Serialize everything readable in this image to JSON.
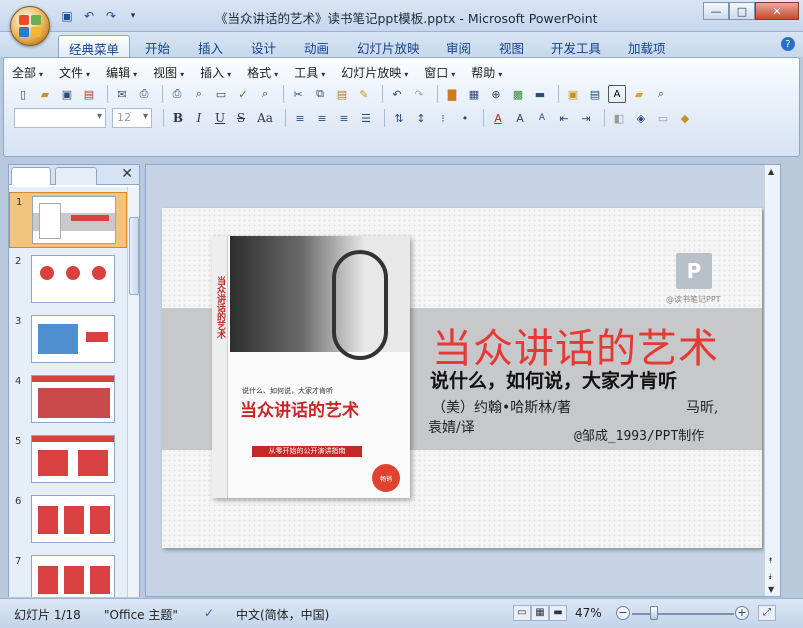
{
  "window": {
    "title": "《当众讲话的艺术》读书笔记ppt模板.pptx - Microsoft PowerPoint",
    "min_label": "—",
    "max_label": "□",
    "close_label": "✕"
  },
  "ribbon_tabs": [
    "经典菜单",
    "开始",
    "插入",
    "设计",
    "动画",
    "幻灯片放映",
    "审阅",
    "视图",
    "开发工具",
    "加载项"
  ],
  "help_label": "?",
  "menus": [
    "全部",
    "文件",
    "编辑",
    "视图",
    "插入",
    "格式",
    "工具",
    "幻灯片放映",
    "窗口",
    "帮助"
  ],
  "font": {
    "name": "",
    "size": "12"
  },
  "format_buttons": [
    "B",
    "I",
    "U",
    "S",
    "Aa"
  ],
  "thumbnails": {
    "numbers": [
      "1",
      "2",
      "3",
      "4",
      "5",
      "6",
      "7"
    ],
    "selected": "1",
    "close_label": "✕"
  },
  "slide": {
    "title": "当众讲话的艺术",
    "subtitle": "说什么，如何说，大家才肯听",
    "author": "（美）约翰•哈斯林/著",
    "translator_a": "马昕,",
    "translator_b": "袁婧/译",
    "credit": "@邹成_1993/PPT制作",
    "logo_letter": "P",
    "logo_caption": "@读书笔记PPT",
    "book": {
      "spine": "当众讲话的艺术",
      "tagline": "说什么、如何说，大家才肯听",
      "title": "当众讲话的艺术",
      "banner": "从零开始的公开演讲指南",
      "seal": "畅销"
    }
  },
  "status": {
    "slide_info": "幻灯片 1/18",
    "theme": "\"Office 主题\"",
    "language": "中文(简体，中国)",
    "zoom": "47%",
    "zoom_level": 0.47
  }
}
